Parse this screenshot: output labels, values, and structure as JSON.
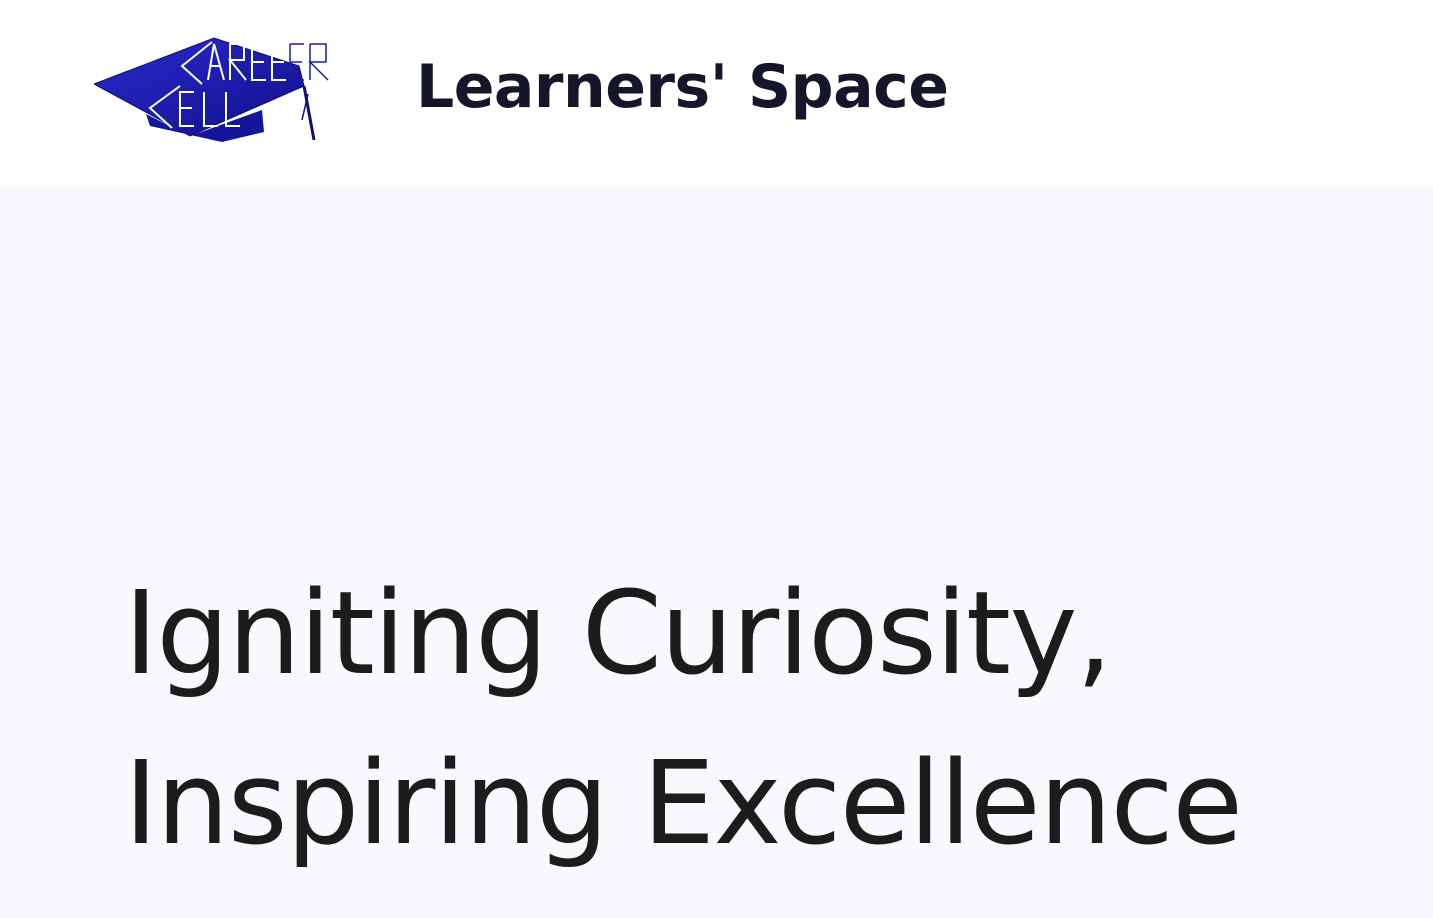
{
  "header": {
    "logo_text": "CAREER CELL",
    "logo_icon": "graduation-cap-icon",
    "title": "Learners' Space"
  },
  "hero": {
    "heading_line1": "Igniting Curiosity,",
    "heading_line2": "Inspiring Excellence"
  },
  "colors": {
    "logo_blue": "#1a1aa8",
    "title_text": "#16162a",
    "hero_background": "#f8f8fd",
    "heading_text": "#1c1c1c"
  }
}
